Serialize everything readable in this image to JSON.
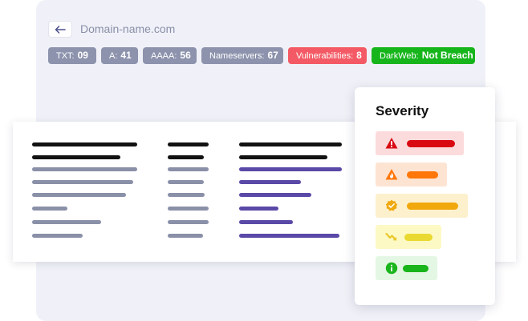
{
  "header": {
    "back_icon": "arrow-left-icon",
    "domain": "Domain-name.com"
  },
  "chips": [
    {
      "label": "TXT:",
      "value": "09",
      "status": "neutral"
    },
    {
      "label": "A:",
      "value": "41",
      "status": "neutral"
    },
    {
      "label": "AAAA:",
      "value": "56",
      "status": "neutral"
    },
    {
      "label": "Nameservers:",
      "value": "67",
      "status": "neutral"
    },
    {
      "label": "Vulnerabilities:",
      "value": "8",
      "status": "danger"
    },
    {
      "label": "DarkWeb:",
      "value": "Not Breach",
      "status": "success"
    }
  ],
  "severity": {
    "title": "Severity",
    "levels": [
      {
        "icon": "alert-triangle-icon",
        "color": "#d90912",
        "bg": "#fcdbdd"
      },
      {
        "icon": "flame-icon",
        "color": "#ff7708",
        "bg": "#fde4d2"
      },
      {
        "icon": "badge-check-icon",
        "color": "#f0a80c",
        "bg": "#fdf0cd"
      },
      {
        "icon": "trend-down-icon",
        "color": "#e9d931",
        "bg": "#fcf9c4"
      },
      {
        "icon": "info-icon",
        "color": "#1ab51c",
        "bg": "#e4f7e4"
      }
    ]
  },
  "colors": {
    "panel_bg": "#f0f1f8",
    "chip_neutral": "#8d93ad",
    "chip_danger": "#f35a65",
    "chip_success": "#17b51c",
    "bar_header": "#121212",
    "bar_gray": "#8a90a8",
    "bar_accent": "#5b49a8"
  }
}
